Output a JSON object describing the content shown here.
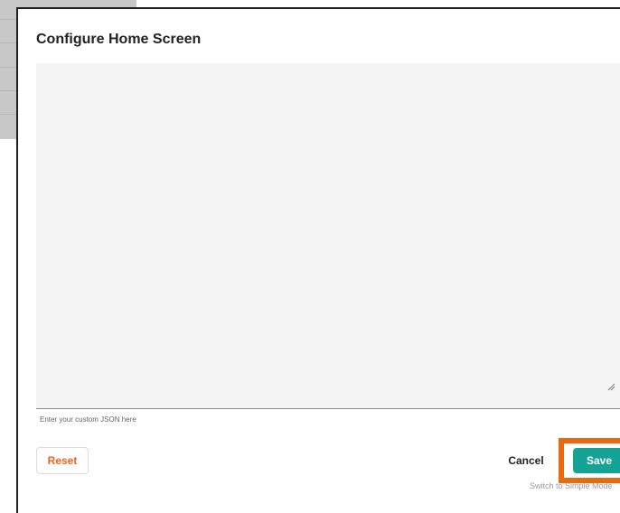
{
  "dialog": {
    "title": "Configure Home Screen",
    "editor": {
      "value": "",
      "helper_text": "Enter your custom JSON here"
    },
    "buttons": {
      "reset_label": "Reset",
      "cancel_label": "Cancel",
      "save_label": "Save"
    },
    "switch_mode_label": "Switch to Simple Mode"
  },
  "colors": {
    "reset_text": "#f06522",
    "save_background": "#14a395",
    "highlight_border": "#e8690f",
    "editor_background": "#f4f4f4"
  },
  "icons": {
    "editor_resize": "resize-grip-icon"
  }
}
